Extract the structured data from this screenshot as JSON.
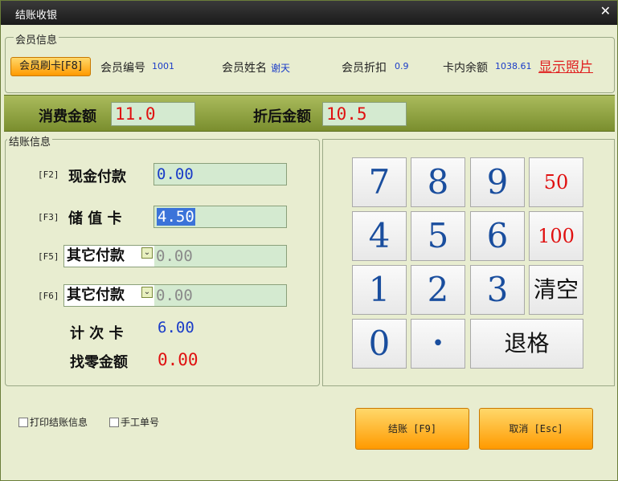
{
  "window": {
    "title": "结账收银"
  },
  "member": {
    "legend": "会员信息",
    "swipe_button": "会员刷卡[F8]",
    "id_label": "会员编号",
    "id_value": "1001",
    "name_label": "会员姓名",
    "name_value": "谢天",
    "discount_label": "会员折扣",
    "discount_value": "0.9",
    "balance_label": "卡内余额",
    "balance_value": "1038.61",
    "show_photo": "显示照片"
  },
  "amounts": {
    "consume_label": "消费金额",
    "consume_value": "11.0",
    "after_label": "折后金额",
    "after_value": "10.5"
  },
  "checkout": {
    "legend": "结账信息",
    "cash": {
      "key": "[F2]",
      "label": "现金付款",
      "value": "0.00"
    },
    "stored": {
      "key": "[F3]",
      "label": "储 值 卡",
      "value": "4.50"
    },
    "other1": {
      "key": "[F5]",
      "label": "其它付款",
      "value": "0.00"
    },
    "other2": {
      "key": "[F6]",
      "label": "其它付款",
      "value": "0.00"
    },
    "count_card": {
      "label": "计 次 卡",
      "value": "6.00"
    },
    "change": {
      "label": "找零金额",
      "value": "0.00"
    }
  },
  "keypad": {
    "k7": "7",
    "k8": "8",
    "k9": "9",
    "k50": "50",
    "k4": "4",
    "k5": "5",
    "k6": "6",
    "k100": "100",
    "k1": "1",
    "k2": "2",
    "k3": "3",
    "clear": "清空",
    "k0": "0",
    "dot": "•",
    "backspace": "退格"
  },
  "options": {
    "print_info": "打印结账信息",
    "manual_no": "手工单号"
  },
  "buttons": {
    "checkout": "结账 [F9]",
    "cancel": "取消 [Esc]"
  },
  "colors": {
    "accent": "#ff9a00",
    "amount_red": "#e01010",
    "value_blue": "#1a3cc8"
  }
}
